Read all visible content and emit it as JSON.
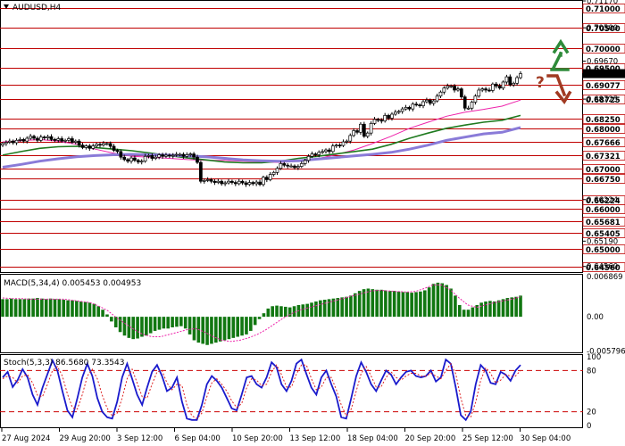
{
  "symbol_label": "AUDUSD,H4",
  "macd_label": "MACD(5,34,4) 0.005453 0.004953",
  "stoch_label": "Stoch(5,3,3) 86.5680 73.3543",
  "colors": {
    "level_line": "#c00000",
    "candle": "#000000",
    "ma_fast": "#ee22aa",
    "ma_mid": "#1f7a1f",
    "ma_slow": "#8a7bd8",
    "macd_hist": "#117711",
    "macd_signal": "#ee22aa",
    "stoch_main": "#1a1acc",
    "stoch_signal": "#dd2222",
    "stoch_level": "#cc0000",
    "up_arrow": "#2e8b3a",
    "down_arrow": "#a13a22",
    "question_mark": "#a13a22",
    "current_price_tag": "#000000"
  },
  "chart_data": [
    {
      "type": "candlestick",
      "title": "AUDUSD,H4",
      "ylim": [
        0.6442,
        0.7117
      ],
      "current_price": 0.6936,
      "price_axis_labels": [
        "0.71170",
        "0.70500",
        "0.69670",
        "0.68725",
        "0.66224",
        "0.65190",
        "0.64560"
      ],
      "level_labels": [
        "0.71000",
        "0.70500",
        "0.70000",
        "0.69500",
        "0.69077",
        "0.68725",
        "0.68250",
        "0.68000",
        "0.67666",
        "0.67321",
        "0.67000",
        "0.66750",
        "0.66224",
        "0.66000",
        "0.65681",
        "0.65405",
        "0.65000",
        "0.64560"
      ],
      "time_labels": [
        "27 Aug 2024",
        "29 Aug 20:00",
        "3 Sep 12:00",
        "6 Sep 04:00",
        "10 Sep 20:00",
        "13 Sep 12:00",
        "18 Sep 04:00",
        "20 Sep 20:00",
        "25 Sep 12:00",
        "30 Sep 04:00"
      ],
      "closes": [
        0.6762,
        0.6765,
        0.6768,
        0.6764,
        0.677,
        0.6772,
        0.6768,
        0.6775,
        0.678,
        0.6775,
        0.677,
        0.6778,
        0.6776,
        0.6779,
        0.6772,
        0.677,
        0.6774,
        0.6768,
        0.677,
        0.6774,
        0.6765,
        0.6768,
        0.6758,
        0.6752,
        0.6756,
        0.675,
        0.6756,
        0.676,
        0.6758,
        0.6762,
        0.6762,
        0.6755,
        0.6745,
        0.6742,
        0.6728,
        0.6722,
        0.6718,
        0.6726,
        0.672,
        0.6716,
        0.6718,
        0.673,
        0.6732,
        0.6725,
        0.6728,
        0.6734,
        0.673,
        0.6733,
        0.6731,
        0.6733,
        0.6735,
        0.6735,
        0.673,
        0.6734,
        0.6736,
        0.6728,
        0.6715,
        0.6668,
        0.667,
        0.6672,
        0.6668,
        0.6665,
        0.6668,
        0.6662,
        0.6664,
        0.6668,
        0.6665,
        0.6662,
        0.6668,
        0.6664,
        0.666,
        0.6665,
        0.6662,
        0.6666,
        0.666,
        0.6678,
        0.6672,
        0.6685,
        0.669,
        0.67,
        0.6712,
        0.6708,
        0.6706,
        0.6706,
        0.6702,
        0.6705,
        0.6712,
        0.672,
        0.673,
        0.6736,
        0.6734,
        0.674,
        0.6742,
        0.6746,
        0.6742,
        0.6756,
        0.6758,
        0.6757,
        0.6766,
        0.6768,
        0.6782,
        0.6794,
        0.679,
        0.681,
        0.678,
        0.6788,
        0.6812,
        0.6822,
        0.682,
        0.6818,
        0.6832,
        0.6825,
        0.6835,
        0.684,
        0.6842,
        0.6848,
        0.6852,
        0.6848,
        0.686,
        0.6858,
        0.6856,
        0.6866,
        0.687,
        0.6862,
        0.6868,
        0.688,
        0.689,
        0.69,
        0.6905,
        0.6905,
        0.6895,
        0.6898,
        0.6878,
        0.685,
        0.685,
        0.6865,
        0.688,
        0.6895,
        0.6898,
        0.6895,
        0.6894,
        0.691,
        0.6905,
        0.69,
        0.6915,
        0.6928,
        0.6908,
        0.6912,
        0.6926,
        0.6936
      ],
      "moving_averages": [
        {
          "values": [
            0.6766,
            0.6769,
            0.6772,
            0.6768,
            0.676,
            0.6748,
            0.6738,
            0.673,
            0.6728,
            0.6725,
            0.6722,
            0.672,
            0.672,
            0.6718,
            0.6716,
            0.6715,
            0.6718,
            0.6724,
            0.6734,
            0.6746,
            0.6762,
            0.678,
            0.68,
            0.6815,
            0.683,
            0.684,
            0.6847,
            0.6855,
            0.687
          ]
        },
        {
          "values": [
            0.6733,
            0.6742,
            0.675,
            0.6754,
            0.6755,
            0.6752,
            0.6748,
            0.6744,
            0.6738,
            0.6732,
            0.6726,
            0.6721,
            0.6716,
            0.6714,
            0.6714,
            0.6718,
            0.6725,
            0.673,
            0.6736,
            0.6742,
            0.6748,
            0.676,
            0.6775,
            0.6788,
            0.68,
            0.6808,
            0.6815,
            0.682,
            0.6832
          ]
        },
        {
          "values": [
            0.6703,
            0.671,
            0.6718,
            0.6724,
            0.6729,
            0.6732,
            0.6734,
            0.6735,
            0.6734,
            0.6733,
            0.6731,
            0.6729,
            0.6725,
            0.6721,
            0.6719,
            0.6718,
            0.6719,
            0.6723,
            0.6727,
            0.6731,
            0.6735,
            0.674,
            0.6748,
            0.6758,
            0.677,
            0.6778,
            0.6786,
            0.679,
            0.6802
          ]
        }
      ],
      "annotations": [
        "up-arrow",
        "?",
        "down-arrow"
      ]
    },
    {
      "type": "bar",
      "title": "MACD(5,34,4) 0.005453 0.004953",
      "ylim": [
        -0.0059,
        0.007
      ],
      "axis_labels": [
        "0.006869",
        "0.00",
        "-0.005796"
      ],
      "histogram": [
        0.003,
        0.003,
        0.0031,
        0.003,
        0.003,
        0.003,
        0.0031,
        0.0031,
        0.0032,
        0.0031,
        0.003,
        0.0031,
        0.003,
        0.003,
        0.0029,
        0.0028,
        0.0028,
        0.0027,
        0.0026,
        0.0025,
        0.0024,
        0.0022,
        0.0018,
        0.0012,
        0.0004,
        -0.0008,
        -0.0018,
        -0.0026,
        -0.0032,
        -0.0036,
        -0.0038,
        -0.0037,
        -0.0034,
        -0.0032,
        -0.0028,
        -0.0024,
        -0.0022,
        -0.002,
        -0.002,
        -0.0018,
        -0.0017,
        -0.0016,
        -0.002,
        -0.003,
        -0.004,
        -0.0044,
        -0.0046,
        -0.0048,
        -0.0046,
        -0.0044,
        -0.0042,
        -0.004,
        -0.0038,
        -0.0036,
        -0.0034,
        -0.0032,
        -0.003,
        -0.0024,
        -0.0014,
        -0.0004,
        0.0006,
        0.0014,
        0.0018,
        0.0019,
        0.0018,
        0.0017,
        0.0016,
        0.0018,
        0.002,
        0.0021,
        0.0022,
        0.0024,
        0.0026,
        0.0028,
        0.0029,
        0.003,
        0.0031,
        0.0032,
        0.0033,
        0.0034,
        0.0036,
        0.004,
        0.0044,
        0.0047,
        0.0048,
        0.0047,
        0.0046,
        0.0046,
        0.0045,
        0.0044,
        0.0044,
        0.0043,
        0.0042,
        0.0042,
        0.0041,
        0.0042,
        0.0043,
        0.0045,
        0.005,
        0.0056,
        0.0058,
        0.0057,
        0.0054,
        0.0048,
        0.0036,
        0.002,
        0.0012,
        0.0012,
        0.0016,
        0.002,
        0.0024,
        0.0026,
        0.0027,
        0.0026,
        0.0028,
        0.003,
        0.0032,
        0.0033,
        0.0034,
        0.0036
      ],
      "signal": [
        0.0032,
        0.0031,
        0.0031,
        0.003,
        0.003,
        0.003,
        0.003,
        0.003,
        0.0028,
        0.0026,
        0.0024,
        0.0018,
        0.001,
        -0.0002,
        -0.0012,
        -0.0022,
        -0.003,
        -0.0034,
        -0.0034,
        -0.003,
        -0.0026,
        -0.0022,
        -0.002,
        -0.0026,
        -0.0034,
        -0.004,
        -0.0042,
        -0.004,
        -0.0036,
        -0.003,
        -0.0022,
        -0.0012,
        -0.0002,
        0.0006,
        0.0012,
        0.0016,
        0.002,
        0.0024,
        0.0028,
        0.0032,
        0.0036,
        0.004,
        0.0044,
        0.0045,
        0.0044,
        0.0043,
        0.0042,
        0.0043,
        0.0048,
        0.0054,
        0.0054,
        0.0046,
        0.0032,
        0.002,
        0.0016,
        0.002,
        0.0024,
        0.0027,
        0.003,
        0.0034
      ]
    },
    {
      "type": "line",
      "title": "Stoch(5,3,3) 86.5680 73.3543",
      "ylim": [
        0,
        100
      ],
      "axis_labels": [
        "100",
        "80",
        "20",
        "0"
      ],
      "levels": [
        80,
        20
      ],
      "series": [
        {
          "values": [
            70,
            78,
            56,
            66,
            82,
            70,
            45,
            30,
            55,
            75,
            95,
            80,
            50,
            22,
            12,
            40,
            70,
            90,
            72,
            40,
            20,
            12,
            10,
            35,
            70,
            90,
            68,
            45,
            30,
            55,
            78,
            88,
            72,
            50,
            55,
            70,
            35,
            10,
            8,
            8,
            30,
            60,
            72,
            65,
            55,
            40,
            25,
            22,
            45,
            70,
            72,
            60,
            55,
            70,
            92,
            85,
            60,
            50,
            65,
            90,
            96,
            75,
            55,
            45,
            70,
            80,
            60,
            42,
            12,
            10,
            40,
            72,
            92,
            78,
            60,
            50,
            65,
            80,
            74,
            60,
            70,
            78,
            80,
            72,
            70,
            72,
            80,
            64,
            70,
            96,
            90,
            55,
            15,
            8,
            20,
            60,
            88,
            80,
            62,
            60,
            78,
            74,
            65,
            80,
            88
          ]
        },
        {
          "values": [
            68,
            72,
            70,
            62,
            72,
            74,
            62,
            44,
            42,
            60,
            80,
            86,
            72,
            46,
            26,
            24,
            45,
            72,
            82,
            68,
            44,
            25,
            14,
            18,
            40,
            68,
            82,
            62,
            42,
            40,
            60,
            78,
            80,
            62,
            52,
            60,
            58,
            30,
            14,
            10,
            18,
            42,
            62,
            68,
            60,
            50,
            36,
            26,
            32,
            55,
            68,
            66,
            58,
            60,
            78,
            88,
            74,
            56,
            56,
            75,
            88,
            88,
            68,
            52,
            56,
            70,
            70,
            52,
            30,
            14,
            24,
            50,
            76,
            86,
            72,
            56,
            56,
            70,
            78,
            70,
            66,
            72,
            76,
            76,
            72,
            72,
            76,
            72,
            68,
            80,
            90,
            75,
            40,
            14,
            12,
            34,
            66,
            84,
            76,
            62,
            66,
            74,
            72,
            72,
            80
          ]
        }
      ]
    }
  ]
}
